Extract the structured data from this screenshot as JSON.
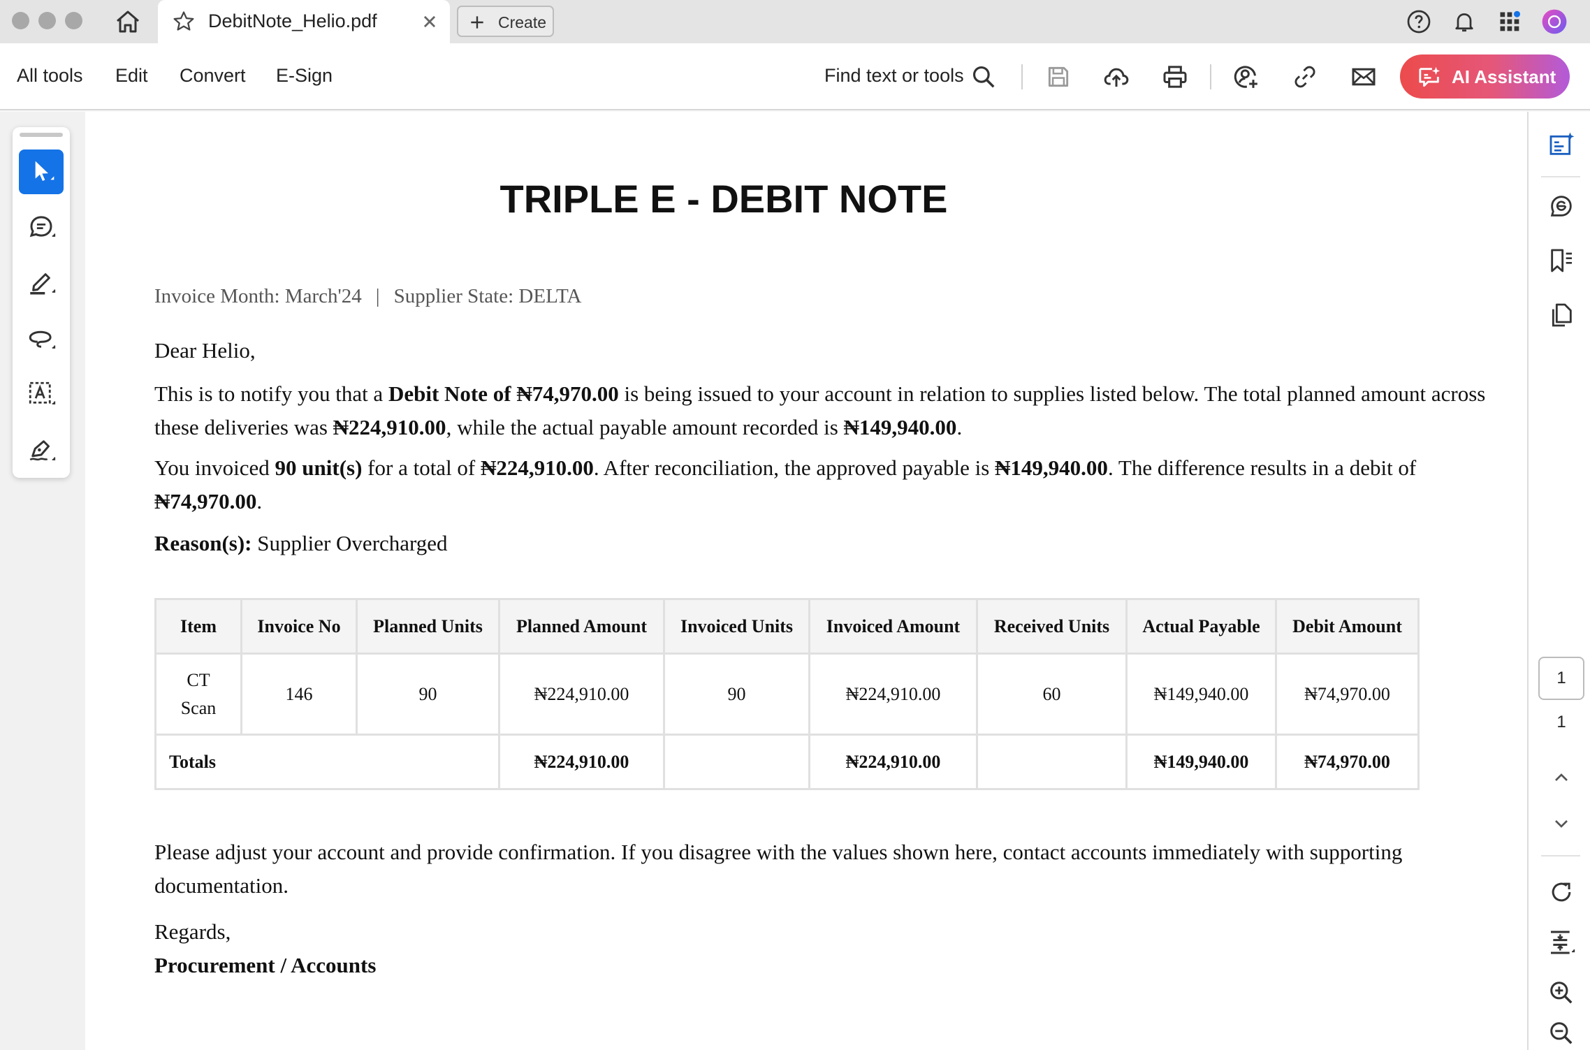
{
  "tabbar": {
    "tab_title": "DebitNote_Helio.pdf",
    "create_label": "Create"
  },
  "toolbar": {
    "menu": [
      "All tools",
      "Edit",
      "Convert",
      "E-Sign"
    ],
    "find_label": "Find text or tools",
    "ai_label": "AI Assistant"
  },
  "document": {
    "title": "TRIPLE E - DEBIT NOTE",
    "invoice_month": "Invoice Month: March'24",
    "separator": "|",
    "supplier_state": "Supplier State: DELTA",
    "greeting": "Dear Helio,",
    "p1": {
      "a": "This is to notify you that a ",
      "b": "Debit Note of ₦74,970.00",
      "c": " is being issued to your account in relation to supplies listed below. The total planned amount across these deliveries was ",
      "d": "₦224,910.00",
      "e": ", while the actual payable amount recorded is ",
      "f": "₦149,940.00",
      "g": "."
    },
    "p2": {
      "a": "You invoiced ",
      "b": "90 unit(s)",
      "c": " for a total of ",
      "d": "₦224,910.00",
      "e": ". After reconciliation, the approved payable is ",
      "f": "₦149,940.00",
      "g": ". The difference results in a debit of ",
      "h": "₦74,970.00",
      "i": "."
    },
    "reason_label": "Reason(s):",
    "reason_value": " Supplier Overcharged",
    "table": {
      "headers": [
        "Item",
        "Invoice No",
        "Planned Units",
        "Planned Amount",
        "Invoiced Units",
        "Invoiced Amount",
        "Received Units",
        "Actual Payable",
        "Debit Amount"
      ],
      "rows": [
        [
          "CT Scan",
          "146",
          "90",
          "₦224,910.00",
          "90",
          "₦224,910.00",
          "60",
          "₦149,940.00",
          "₦74,970.00"
        ]
      ],
      "totals": {
        "label": "Totals",
        "planned_amount": "₦224,910.00",
        "invoiced_amount": "₦224,910.00",
        "actual_payable": "₦149,940.00",
        "debit_amount": "₦74,970.00"
      }
    },
    "closing": "Please adjust your account and provide confirmation. If you disagree with the values shown here, contact accounts immediately with supporting documentation.",
    "regards": "Regards,",
    "signature": "Procurement / Accounts"
  },
  "sidebar": {
    "page_current": "1",
    "page_total": "1"
  },
  "colors": {
    "accent": "#1473e6",
    "ai_gradient_start": "#ec4b4b",
    "ai_gradient_end": "#b35ad9"
  }
}
